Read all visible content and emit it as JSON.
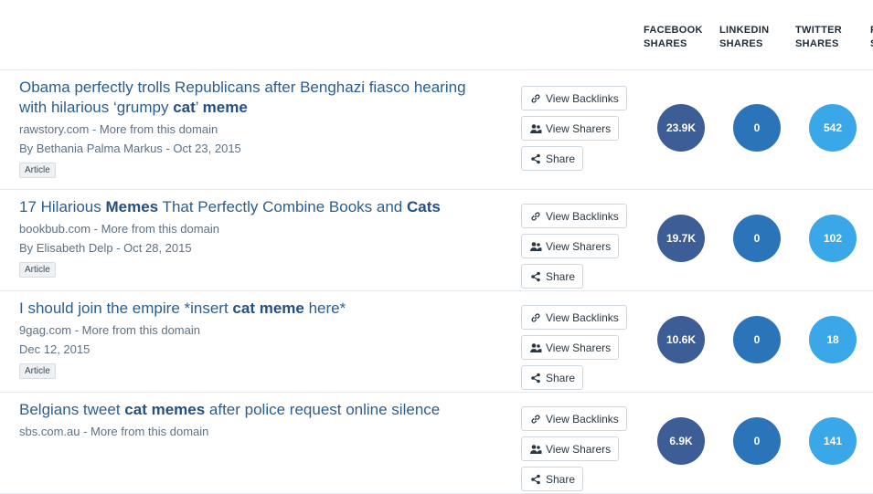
{
  "columns": [
    {
      "line1": "FACEBOOK",
      "line2": "SHARES"
    },
    {
      "line1": "LINKEDIN",
      "line2": "SHARES"
    },
    {
      "line1": "TWITTER",
      "line2": "SHARES"
    },
    {
      "line1": "P",
      "line2": "S"
    }
  ],
  "buttons": {
    "backlinks": "View Backlinks",
    "sharers": "View Sharers",
    "share": "Share"
  },
  "more_link": "More from this domain",
  "colors": {
    "facebook": "#3c5d95",
    "linkedin": "#2b74ba",
    "twitter": "#3aa7e8",
    "title": "#2b5e8e"
  },
  "articles": [
    {
      "title_parts": [
        {
          "t": "Obama perfectly trolls Republicans after Benghazi fiasco hearing with hilarious ‘grumpy ",
          "b": false
        },
        {
          "t": "cat",
          "b": true
        },
        {
          "t": "’ ",
          "b": false
        },
        {
          "t": "meme",
          "b": true
        }
      ],
      "domain": "rawstory.com",
      "author_line": "By Bethania Palma Markus - Oct 23, 2015",
      "type": "Article",
      "facebook": "23.9K",
      "linkedin": "0",
      "twitter": "542"
    },
    {
      "title_parts": [
        {
          "t": "17 Hilarious ",
          "b": false
        },
        {
          "t": "Memes",
          "b": true
        },
        {
          "t": " That Perfectly Combine Books and ",
          "b": false
        },
        {
          "t": "Cats",
          "b": true
        }
      ],
      "domain": "bookbub.com",
      "author_line": "By Elisabeth Delp - Oct 28, 2015",
      "type": "Article",
      "facebook": "19.7K",
      "linkedin": "0",
      "twitter": "102"
    },
    {
      "title_parts": [
        {
          "t": "I should join the empire *insert ",
          "b": false
        },
        {
          "t": "cat meme",
          "b": true
        },
        {
          "t": " here*",
          "b": false
        }
      ],
      "domain": "9gag.com",
      "author_line": "Dec 12, 2015",
      "type": "Article",
      "facebook": "10.6K",
      "linkedin": "0",
      "twitter": "18"
    },
    {
      "title_parts": [
        {
          "t": "Belgians tweet ",
          "b": false
        },
        {
          "t": "cat memes",
          "b": true
        },
        {
          "t": " after police request online silence",
          "b": false
        }
      ],
      "domain": "sbs.com.au",
      "author_line": "",
      "type": "",
      "facebook": "6.9K",
      "linkedin": "0",
      "twitter": "141"
    }
  ]
}
